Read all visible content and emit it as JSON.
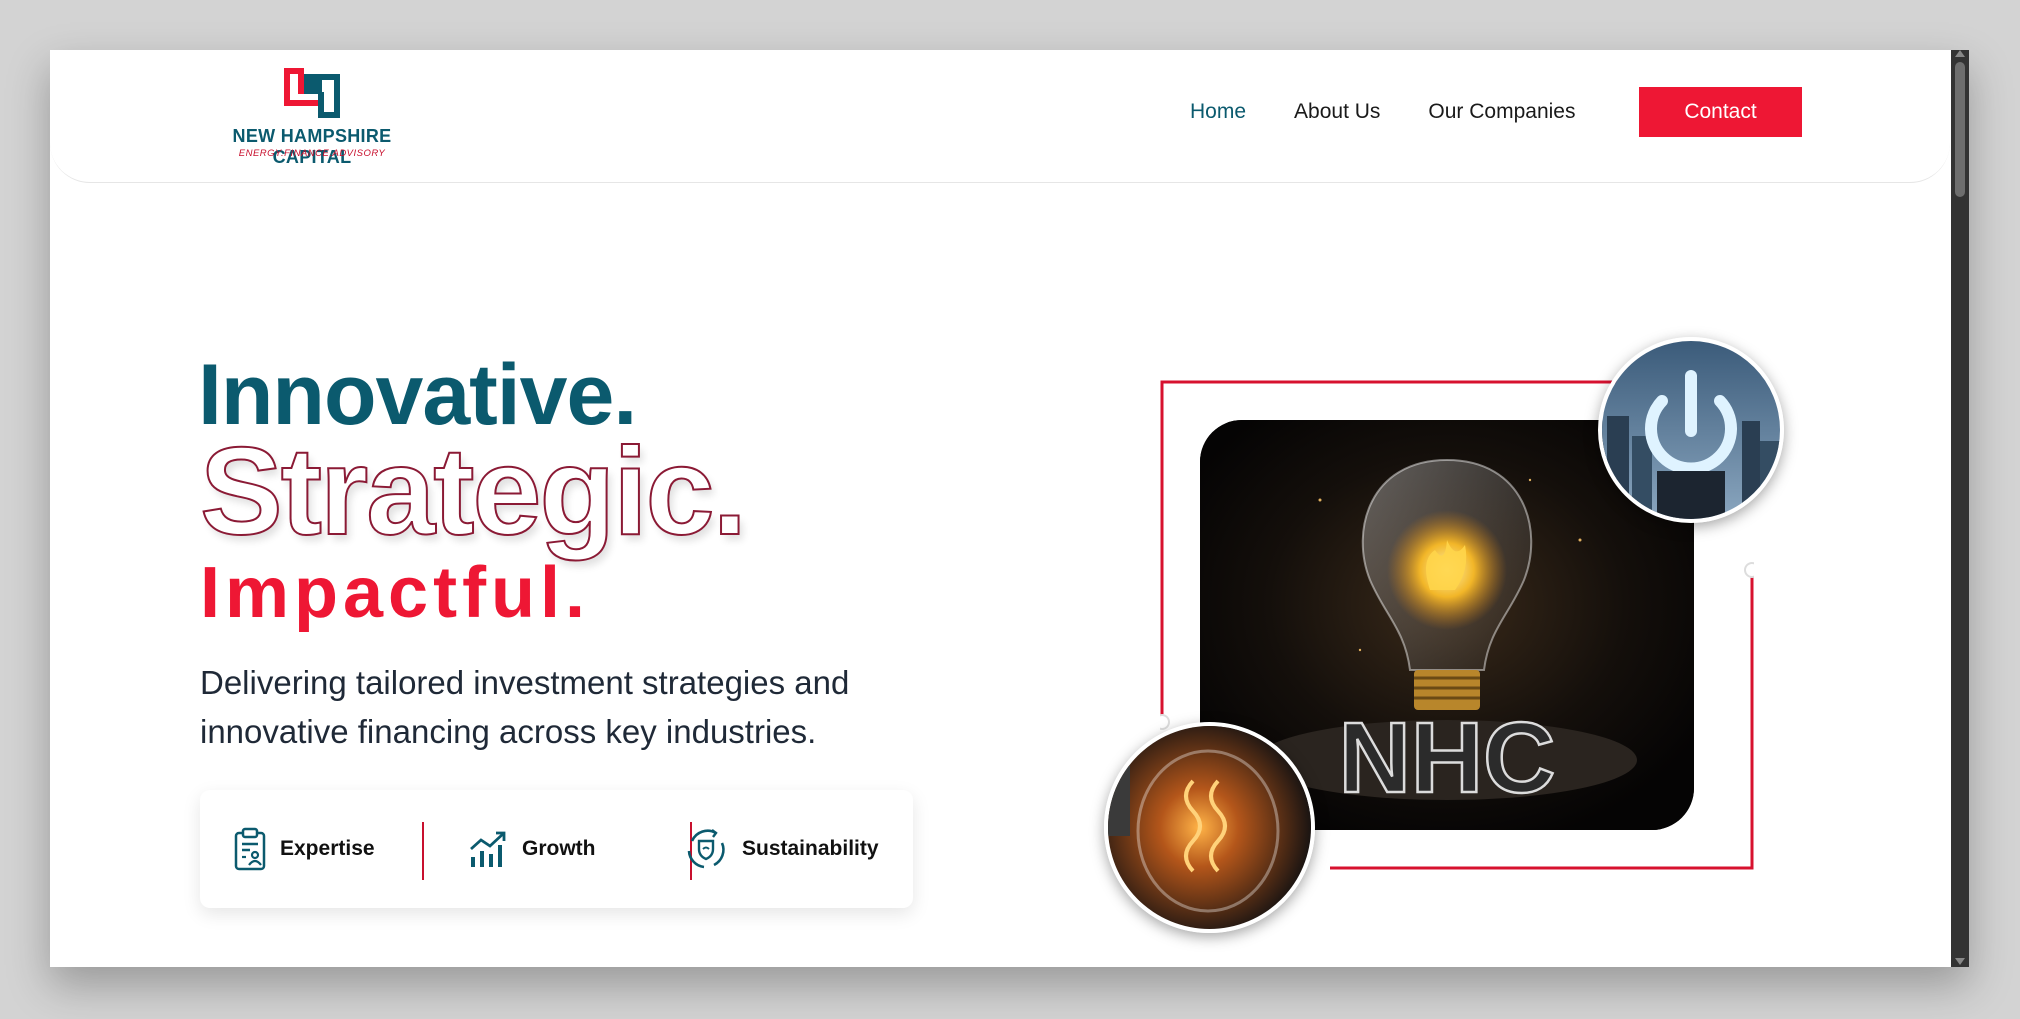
{
  "brand": {
    "name": "NEW HAMPSHIRE CAPITAL",
    "tagline": "ENERGY.FINANCE.ADVISORY",
    "colors": {
      "primary": "#0b5a6e",
      "accent": "#ee1734",
      "outline": "#8b1a35"
    }
  },
  "nav": {
    "items": [
      {
        "label": "Home",
        "active": true
      },
      {
        "label": "About Us",
        "active": false
      },
      {
        "label": "Our Companies",
        "active": false
      }
    ],
    "cta_label": "Contact"
  },
  "hero": {
    "line1": "Innovative.",
    "line2": "Strategic.",
    "line3": "Impactful.",
    "subtitle_line1": "Delivering tailored investment strategies and",
    "subtitle_line2": "innovative financing across key industries."
  },
  "features": [
    {
      "label": "Expertise",
      "icon": "clipboard-user-icon"
    },
    {
      "label": "Growth",
      "icon": "growth-chart-icon"
    },
    {
      "label": "Sustainability",
      "icon": "sustainability-shield-icon"
    }
  ],
  "images": {
    "main": {
      "icon": "lightbulb-image",
      "overlay_text": "NHC"
    },
    "top_circle": {
      "icon": "power-symbol-image"
    },
    "bottom_circle": {
      "icon": "filament-bulb-image"
    }
  }
}
